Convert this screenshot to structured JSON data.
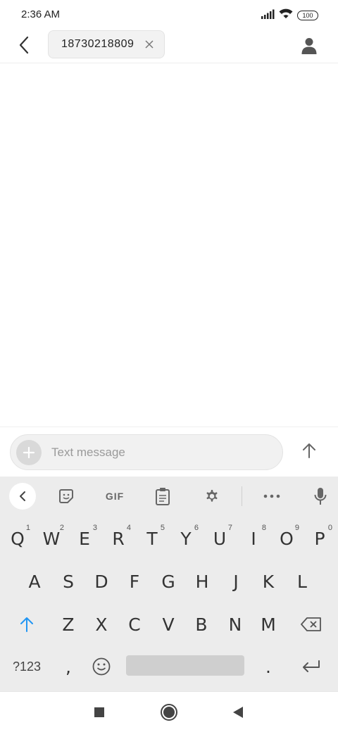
{
  "status_bar": {
    "time": "2:36 AM",
    "battery": "100",
    "icons": [
      "signal-icon",
      "wifi-icon",
      "battery-icon"
    ]
  },
  "header": {
    "recipient": "18730218809",
    "icons": [
      "back-arrow-icon",
      "close-icon",
      "contact-icon"
    ]
  },
  "compose": {
    "placeholder": "Text message",
    "icons": [
      "plus-icon",
      "send-arrow-icon"
    ]
  },
  "keyboard": {
    "toolbar": {
      "gif_label": "GIF",
      "icons": [
        "chevron-left-icon",
        "sticker-icon",
        "clipboard-icon",
        "gear-icon",
        "more-dots-icon",
        "microphone-icon"
      ]
    },
    "row1": [
      {
        "label": "Q",
        "hint": "1"
      },
      {
        "label": "W",
        "hint": "2"
      },
      {
        "label": "E",
        "hint": "3"
      },
      {
        "label": "R",
        "hint": "4"
      },
      {
        "label": "T",
        "hint": "5"
      },
      {
        "label": "Y",
        "hint": "6"
      },
      {
        "label": "U",
        "hint": "7"
      },
      {
        "label": "I",
        "hint": "8"
      },
      {
        "label": "O",
        "hint": "9"
      },
      {
        "label": "P",
        "hint": "0"
      }
    ],
    "row2": [
      "A",
      "S",
      "D",
      "F",
      "G",
      "H",
      "J",
      "K",
      "L"
    ],
    "row3": [
      "Z",
      "X",
      "C",
      "V",
      "B",
      "N",
      "M"
    ],
    "row4": {
      "symbols": "?123",
      "comma": ",",
      "period": "."
    },
    "accent_color": "#2196f3"
  },
  "nav_bar": {
    "icons": [
      "recents-square-icon",
      "home-circle-icon",
      "back-triangle-icon"
    ]
  }
}
